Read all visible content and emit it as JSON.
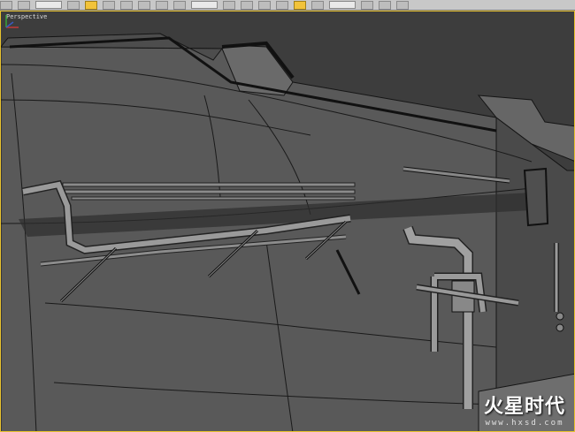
{
  "viewport": {
    "label": "Perspective"
  },
  "watermark": {
    "logo": "火星时代",
    "url": "www.hxsd.com"
  },
  "colors": {
    "viewport_border": "#e8c32e",
    "mesh_face": "#555555",
    "wire": "#1a1a1a",
    "active_tool": "#f2c33a"
  },
  "toolbar": {
    "icons": [
      "undo-icon",
      "redo-icon",
      "link-icon",
      "unlink-icon",
      "bind-icon",
      "select-icon",
      "rect-select-icon",
      "window-crossing-icon",
      "move-icon",
      "rotate-icon",
      "scale-icon",
      "reference-dropdown",
      "pivot-icon",
      "select-manipulate-icon",
      "snap-icon",
      "angle-snap-icon",
      "percent-snap-icon",
      "spinner-snap-icon",
      "named-selection-field",
      "mirror-icon",
      "align-icon"
    ]
  }
}
